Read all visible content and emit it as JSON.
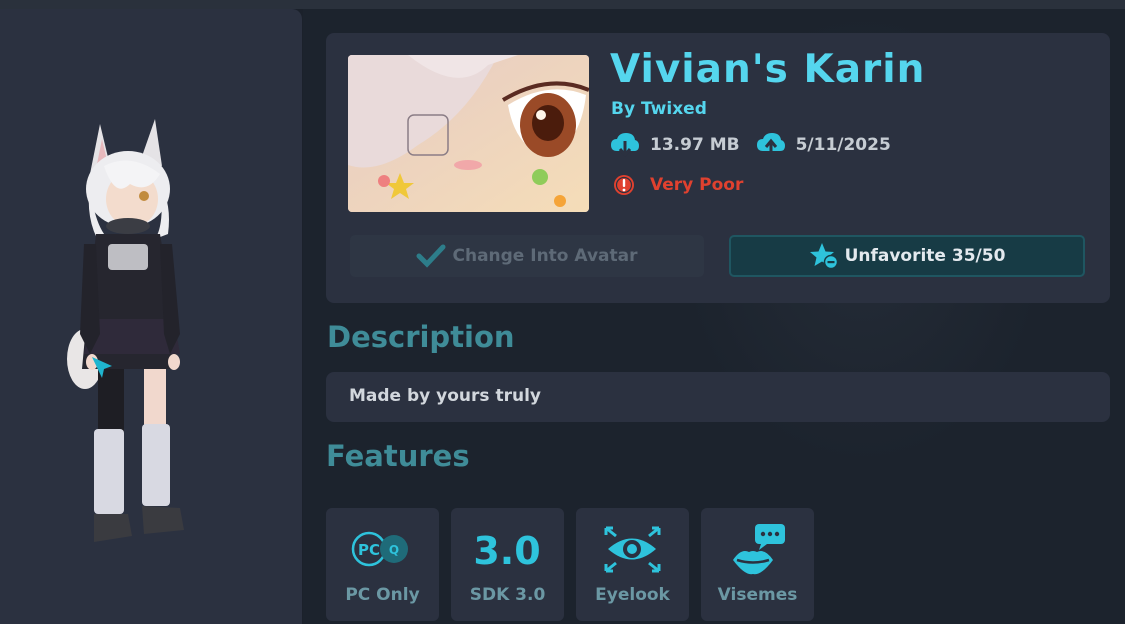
{
  "avatar": {
    "name": "Vivian's Karin",
    "author": "By Twixed",
    "file_size": "13.97 MB",
    "updated": "5/11/2025",
    "performance": "Very Poor"
  },
  "actions": {
    "change_label": "Change Into Avatar",
    "change_enabled": false,
    "favorite_label": "Unfavorite 35/50"
  },
  "description": {
    "heading": "Description",
    "text": "Made by yours truly"
  },
  "features": {
    "heading": "Features",
    "items": [
      {
        "label": "PC Only",
        "icon": "pc-quest-icon"
      },
      {
        "label": "SDK 3.0",
        "icon": "sdk-version-icon",
        "icon_text": "3.0"
      },
      {
        "label": "Eyelook",
        "icon": "eye-tracking-icon"
      },
      {
        "label": "Visemes",
        "icon": "lips-speech-icon"
      }
    ]
  },
  "pc_icon": {
    "pc": "PC",
    "quest": "Q"
  },
  "colors": {
    "accent": "#55d6ee",
    "performance_very_poor": "#e0412f",
    "panel": "#2b3140",
    "background": "#1c232d"
  }
}
